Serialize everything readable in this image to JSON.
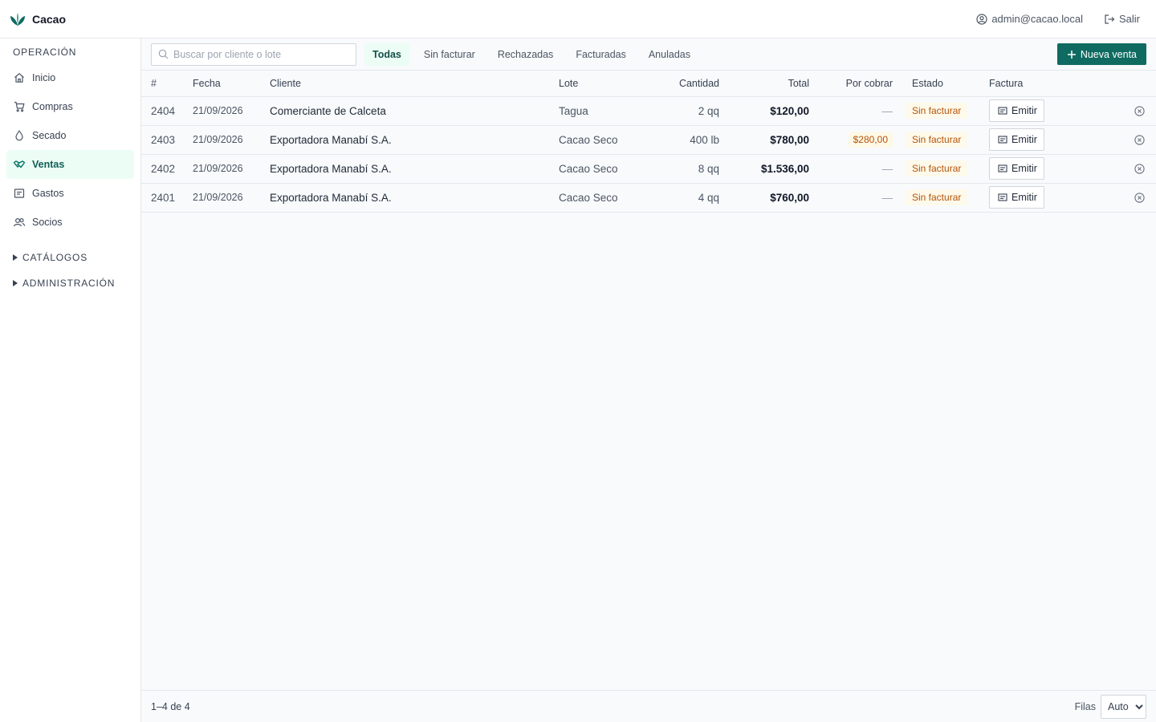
{
  "app": {
    "title": "Cacao"
  },
  "topbar": {
    "user": "admin@cacao.local",
    "logout": "Salir"
  },
  "sidebar": {
    "section": "OPERACIÓN",
    "items": [
      {
        "label": "Inicio",
        "icon": "home-icon"
      },
      {
        "label": "Compras",
        "icon": "cart-icon"
      },
      {
        "label": "Secado",
        "icon": "drop-icon"
      },
      {
        "label": "Ventas",
        "icon": "handshake-icon",
        "active": true
      },
      {
        "label": "Gastos",
        "icon": "receipt-icon"
      },
      {
        "label": "Socios",
        "icon": "users-icon"
      }
    ],
    "groups": [
      "CATÁLOGOS",
      "ADMINISTRACIÓN"
    ]
  },
  "toolbar": {
    "search_placeholder": "Buscar por cliente o lote",
    "tabs": [
      "Todas",
      "Sin facturar",
      "Rechazadas",
      "Facturadas",
      "Anuladas"
    ],
    "active_tab": "Todas",
    "new_button": "Nueva venta"
  },
  "table": {
    "columns": [
      "#",
      "Fecha",
      "Cliente",
      "Lote",
      "Cantidad",
      "Total",
      "Por cobrar",
      "Estado",
      "Factura"
    ],
    "rows": [
      {
        "num": "2404",
        "fecha": "21/09/2026",
        "cliente": "Comerciante de Calceta",
        "lote": "Tagua",
        "cantidad": "2 qq",
        "total": "$120,00",
        "por_cobrar": "—",
        "estado": "Sin facturar",
        "factura": "Emitir"
      },
      {
        "num": "2403",
        "fecha": "21/09/2026",
        "cliente": "Exportadora Manabí S.A.",
        "lote": "Cacao Seco",
        "cantidad": "400 lb",
        "total": "$780,00",
        "por_cobrar": "$280,00",
        "estado": "Sin facturar",
        "factura": "Emitir"
      },
      {
        "num": "2402",
        "fecha": "21/09/2026",
        "cliente": "Exportadora Manabí S.A.",
        "lote": "Cacao Seco",
        "cantidad": "8 qq",
        "total": "$1.536,00",
        "por_cobrar": "—",
        "estado": "Sin facturar",
        "factura": "Emitir"
      },
      {
        "num": "2401",
        "fecha": "21/09/2026",
        "cliente": "Exportadora Manabí S.A.",
        "lote": "Cacao Seco",
        "cantidad": "4 qq",
        "total": "$760,00",
        "por_cobrar": "—",
        "estado": "Sin facturar",
        "factura": "Emitir"
      }
    ]
  },
  "footer": {
    "range": "1–4 de 4",
    "rows_label": "Filas",
    "rows_value": "Auto"
  },
  "colors": {
    "accent": "#0f6b61",
    "active_bg": "#ecfdf5",
    "warning_text": "#b45309",
    "warning_bg": "#fefaeb"
  }
}
